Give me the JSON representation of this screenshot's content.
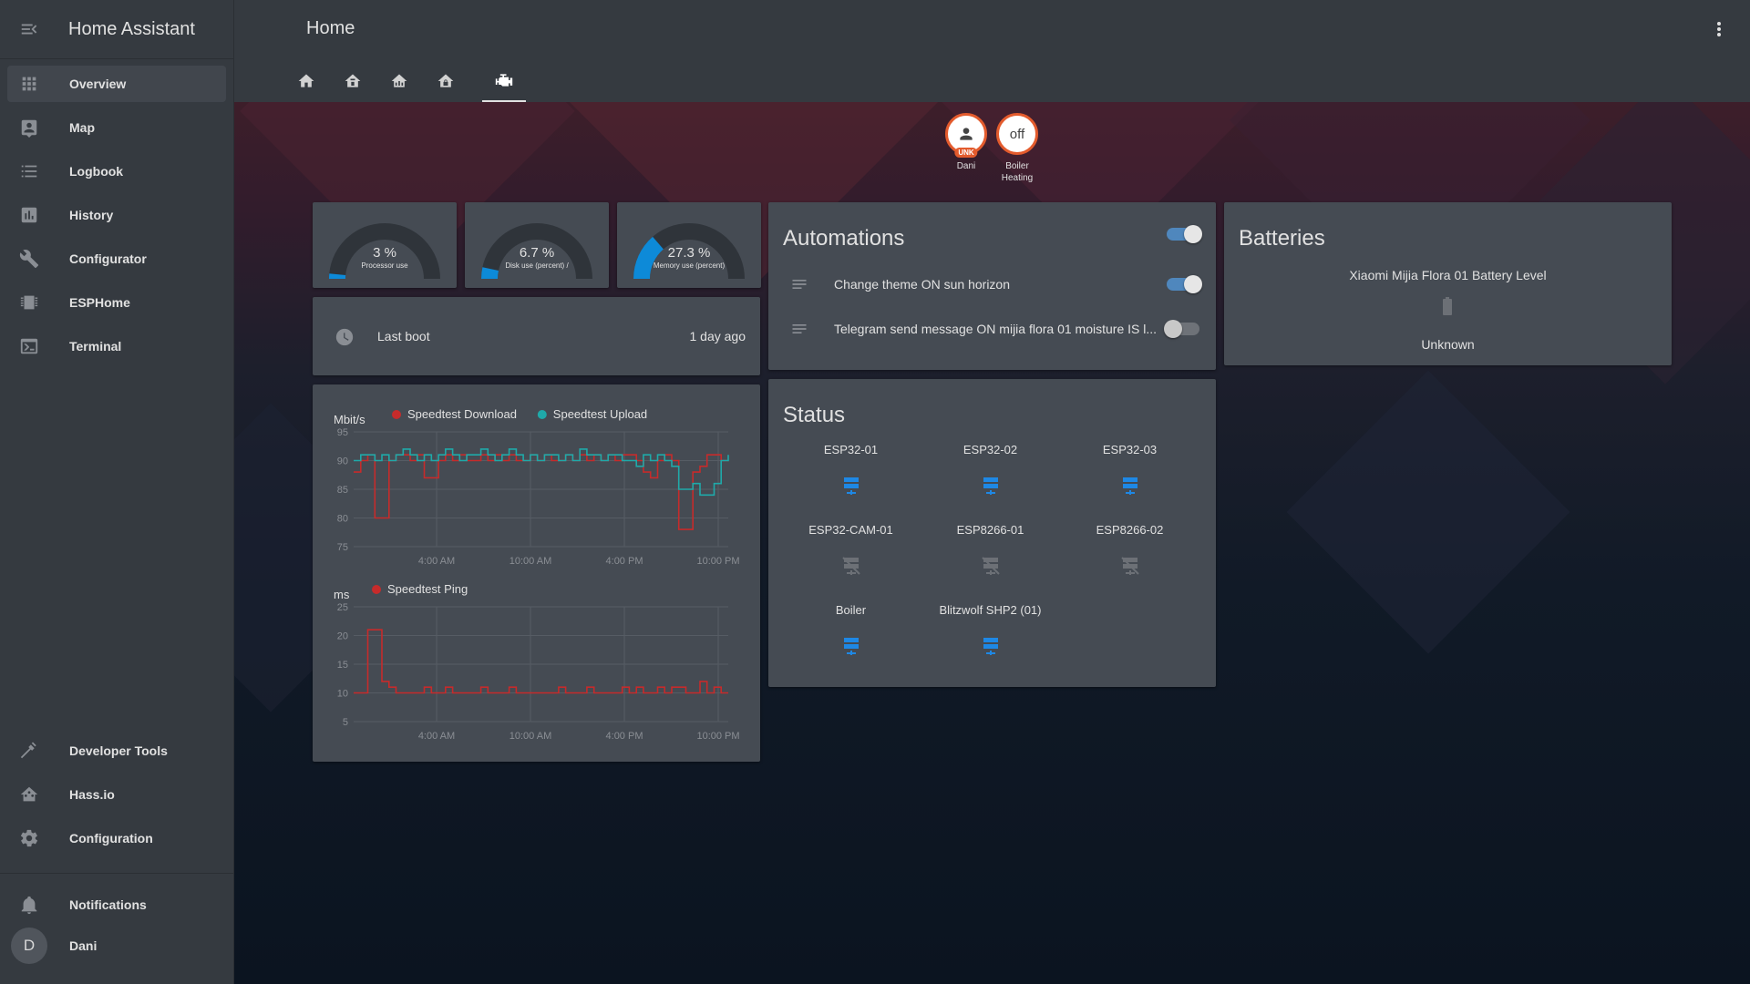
{
  "app": {
    "title": "Home Assistant"
  },
  "sidebar": {
    "items": [
      {
        "label": "Overview",
        "icon": "grid-icon",
        "active": true
      },
      {
        "label": "Map",
        "icon": "map-icon"
      },
      {
        "label": "Logbook",
        "icon": "logbook-icon"
      },
      {
        "label": "History",
        "icon": "history-icon"
      },
      {
        "label": "Configurator",
        "icon": "wrench-icon"
      },
      {
        "label": "ESPHome",
        "icon": "chip-icon"
      },
      {
        "label": "Terminal",
        "icon": "terminal-icon"
      }
    ],
    "bottom_items": [
      {
        "label": "Developer Tools",
        "icon": "hammer-icon"
      },
      {
        "label": "Hass.io",
        "icon": "hassio-icon"
      },
      {
        "label": "Configuration",
        "icon": "gear-icon"
      }
    ],
    "notifications_label": "Notifications",
    "user": {
      "name": "Dani",
      "initial": "D"
    }
  },
  "header": {
    "title": "Home",
    "tabs": [
      {
        "icon": "home-icon"
      },
      {
        "icon": "home-variant-icon"
      },
      {
        "icon": "home-floor-icon"
      },
      {
        "icon": "home-lock-icon"
      },
      {
        "icon": "engine-icon",
        "active": true
      }
    ]
  },
  "badges": [
    {
      "name": "Dani",
      "tag": "UNK",
      "icon": "person-icon"
    },
    {
      "name_line1": "Boiler",
      "name_line2": "Heating",
      "value": "off"
    }
  ],
  "gauges": [
    {
      "value": "3 %",
      "name": "Processor use",
      "percent": 3
    },
    {
      "value": "6.7 %",
      "name": "Disk use (percent) /",
      "percent": 6.7
    },
    {
      "value": "27.3 %",
      "name": "Memory use (percent)",
      "percent": 27.3
    }
  ],
  "last_boot": {
    "label": "Last boot",
    "value": "1 day ago"
  },
  "automations": {
    "title": "Automations",
    "master_on": true,
    "items": [
      {
        "label": "Change theme ON sun horizon",
        "on": true
      },
      {
        "label": "Telegram send message ON mijia flora 01 moisture IS l...",
        "on": false
      }
    ]
  },
  "batteries": {
    "title": "Batteries",
    "entity": "Xiaomi Mijia Flora 01 Battery Level",
    "state": "Unknown"
  },
  "status": {
    "title": "Status",
    "items": [
      {
        "name": "ESP32-01",
        "online": true
      },
      {
        "name": "ESP32-02",
        "online": true
      },
      {
        "name": "ESP32-03",
        "online": true
      },
      {
        "name": "ESP32-CAM-01",
        "online": false
      },
      {
        "name": "ESP8266-01",
        "online": false
      },
      {
        "name": "ESP8266-02",
        "online": false
      },
      {
        "name": "Boiler",
        "online": true
      },
      {
        "name": "Blitzwolf SHP2 (01)",
        "online": true
      }
    ]
  },
  "colors": {
    "download": "#c62b2b",
    "upload": "#1fa9a9",
    "ping": "#c62b2b",
    "gauge": "#0d8ad8",
    "online": "#1e88e5",
    "offline": "#6c7076"
  },
  "chart_data": [
    {
      "type": "line",
      "ylabel": "Mbit/s",
      "ylim": [
        75,
        95
      ],
      "yticks": [
        95,
        90,
        85,
        80,
        75
      ],
      "xticks": [
        "4:00 AM",
        "10:00 AM",
        "4:00 PM",
        "10:00 PM"
      ],
      "series": [
        {
          "name": "Speedtest Download",
          "color": "#c62b2b",
          "values": [
            88,
            90,
            91,
            80,
            80,
            90,
            91,
            91,
            90,
            91,
            87,
            87,
            90,
            91,
            90,
            91,
            90,
            90,
            91,
            90,
            91,
            90,
            91,
            90,
            90,
            91,
            90,
            91,
            90,
            90,
            91,
            90,
            91,
            90,
            91,
            90,
            91,
            90,
            91,
            91,
            90,
            88,
            87,
            90,
            91,
            90,
            78,
            78,
            88,
            89,
            91,
            91,
            90,
            90
          ]
        },
        {
          "name": "Speedtest Upload",
          "color": "#1fa9a9",
          "values": [
            90,
            91,
            91,
            90,
            91,
            90,
            91,
            92,
            91,
            90,
            91,
            90,
            91,
            92,
            91,
            90,
            91,
            91,
            92,
            91,
            90,
            91,
            92,
            91,
            90,
            91,
            90,
            91,
            91,
            90,
            91,
            90,
            92,
            91,
            91,
            90,
            91,
            91,
            90,
            90,
            89,
            91,
            90,
            91,
            90,
            89,
            85,
            85,
            86,
            84,
            84,
            86,
            90,
            91
          ]
        }
      ]
    },
    {
      "type": "line",
      "ylabel": "ms",
      "ylim": [
        5,
        25
      ],
      "yticks": [
        25,
        20,
        15,
        10,
        5
      ],
      "xticks": [
        "4:00 AM",
        "10:00 AM",
        "4:00 PM",
        "10:00 PM"
      ],
      "series": [
        {
          "name": "Speedtest Ping",
          "color": "#c62b2b",
          "values": [
            10,
            10,
            21,
            21,
            12,
            11,
            10,
            10,
            10,
            10,
            11,
            10,
            10,
            11,
            10,
            10,
            10,
            10,
            11,
            10,
            10,
            10,
            11,
            10,
            10,
            10,
            10,
            10,
            10,
            11,
            10,
            10,
            10,
            11,
            10,
            10,
            10,
            10,
            11,
            10,
            11,
            10,
            10,
            11,
            10,
            11,
            11,
            10,
            10,
            12,
            10,
            11,
            10,
            10
          ]
        }
      ]
    }
  ]
}
